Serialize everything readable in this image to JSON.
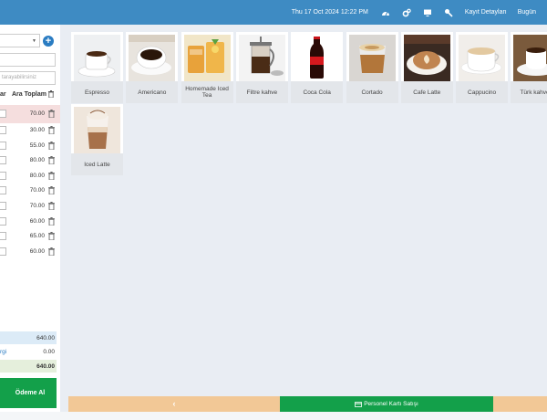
{
  "topbar": {
    "datetime": "Thu 17 Oct 2024 12:22 PM",
    "icons": [
      "dashboard-icon",
      "settings-icon",
      "monitor-icon",
      "wrench-icon"
    ],
    "links": [
      "Kayıt Detayları",
      "Bugün"
    ]
  },
  "left": {
    "search_placeholder": "tarayabilirsiniz",
    "columns": {
      "col1": "ar",
      "col2": "Ara Toplam"
    },
    "rows": [
      "70.00",
      "30.00",
      "55.00",
      "80.00",
      "80.00",
      "70.00",
      "70.00",
      "60.00",
      "65.00",
      "60.00"
    ],
    "totals": [
      {
        "label": "",
        "value": "640.00"
      },
      {
        "label": "rgi",
        "value": "0.00"
      },
      {
        "label": "",
        "value": "640.00"
      }
    ],
    "pay_label": "Ödeme Al"
  },
  "products": [
    {
      "name": "Espresso",
      "icon": "espresso-photo"
    },
    {
      "name": "Americano",
      "icon": "americano-photo"
    },
    {
      "name": "Homemade Iced Tea",
      "icon": "iced-tea-photo"
    },
    {
      "name": "Filtre kahve",
      "icon": "french-press-photo"
    },
    {
      "name": "Coca Cola",
      "icon": "cola-photo"
    },
    {
      "name": "Cortado",
      "icon": "cortado-photo"
    },
    {
      "name": "Cafe Latte",
      "icon": "latte-photo"
    },
    {
      "name": "Cappucino",
      "icon": "cappuccino-photo"
    },
    {
      "name": "Türk kahvesi",
      "icon": "turkish-coffee-photo"
    },
    {
      "name": "Iced Latte",
      "icon": "iced-latte-photo"
    }
  ],
  "bottom": {
    "back_glyph": "‹",
    "staff_label": "Personel Kartı Satışı"
  },
  "colors": {
    "topbar": "#3e8bc3",
    "green": "#13a04a",
    "orange": "#f2c896",
    "accent": "#2a7cc2"
  }
}
